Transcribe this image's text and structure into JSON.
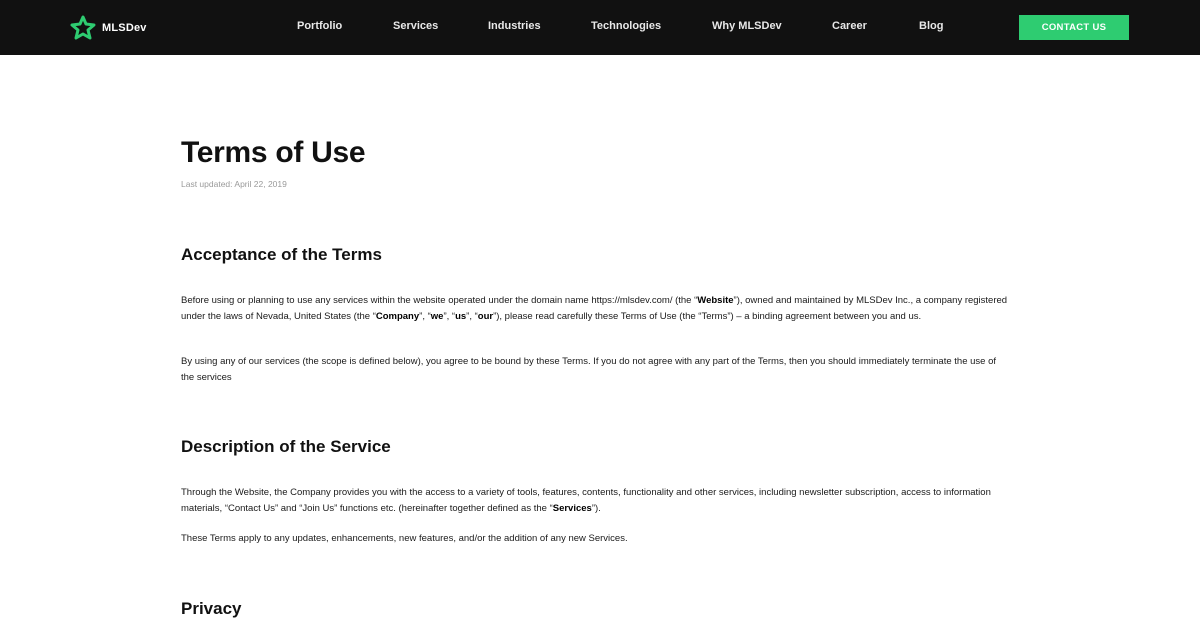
{
  "header": {
    "logo_text": "MLSDev",
    "nav": [
      "Portfolio",
      "Services",
      "Industries",
      "Technologies",
      "Why MLSDev",
      "Career",
      "Blog"
    ],
    "cta_label": "CONTACT US",
    "accent": "#2ecc71",
    "background": "#111111"
  },
  "page": {
    "title": "Terms of Use",
    "updated": "Last updated: April 22, 2019"
  },
  "sections": [
    {
      "heading": "Acceptance of the Terms",
      "paragraphs": [
        [
          "Before using or planning to use any services within the website operated under the domain name https://mlsdev.com/ (the “",
          "Website",
          "”), owned and maintained by MLSDev Inc., a company registered under the laws of Nevada, United States (the “",
          "Company",
          "”, “",
          "we",
          "”, “",
          "us",
          "”, “",
          "our",
          "”), please read carefully these Terms of Use (the “Terms”) – a binding agreement between you and us."
        ],
        [
          "By using any of our services (the scope is defined below), you agree to be bound by these Terms. If you do not agree with any part of the Terms, then you should immediately terminate the use of the services"
        ]
      ]
    },
    {
      "heading": "Description of the Service",
      "paragraphs": [
        [
          "Through the Website, the Company provides you with the access to a variety of tools, features, contents, functionality and other services, including newsletter subscription, access to information materials, “Contact Us” and “Join Us” functions etc. (hereinafter together defined as the “",
          "Services",
          "”)."
        ],
        [
          "These Terms apply to any updates, enhancements, new features, and/or the addition of any new Services."
        ]
      ]
    },
    {
      "heading": "Privacy",
      "paragraphs": []
    }
  ]
}
